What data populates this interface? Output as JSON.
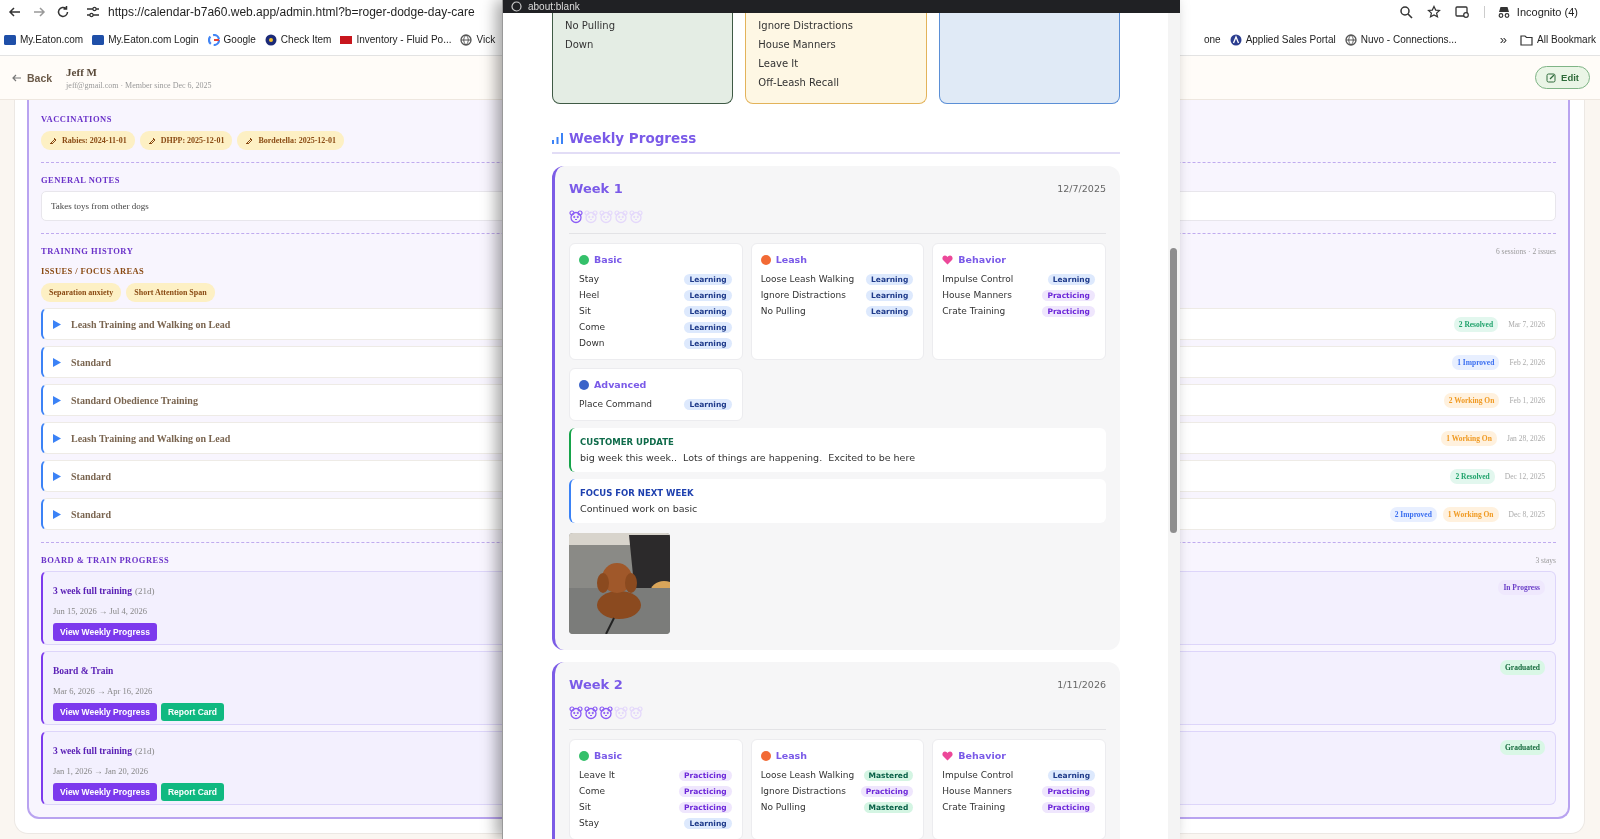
{
  "browser": {
    "url": "https://calendar-b7a60.web.app/admin.html?b=roger-dodge-day-care",
    "profile": "Incognito (4)",
    "bookmarks_left": [
      {
        "label": "My.Eaton.com"
      },
      {
        "label": "My.Eaton.com Login"
      },
      {
        "label": "Google"
      },
      {
        "label": "Check Item"
      },
      {
        "label": "Inventory - Fluid Po..."
      },
      {
        "label": "Vick"
      }
    ],
    "bookmarks_right": [
      {
        "label": "one"
      },
      {
        "label": "Applied Sales Portal"
      },
      {
        "label": "Nuvo - Connections..."
      }
    ],
    "more": "»",
    "all_bookmarks": "All Bookmark"
  },
  "page": {
    "back": "Back",
    "name": "Jeff M",
    "meta": "jeff@gmail.com · Member since Dec 6, 2025",
    "edit": "Edit",
    "vaccinations": {
      "heading": "VACCINATIONS",
      "items": [
        "Rabies: 2024-11-01",
        "DHPP: 2025-12-01",
        "Bordetella: 2025-12-01"
      ]
    },
    "notes": {
      "heading": "GENERAL NOTES",
      "value": "Takes toys from other dogs"
    },
    "training": {
      "heading": "TRAINING HISTORY",
      "summary": "6 sessions · 2 issues",
      "issues_heading": "ISSUES / FOCUS AREAS",
      "issues": [
        "Separation anxiety",
        "Short Attention Span"
      ],
      "sessions": [
        {
          "title": "Leash Training and Walking on Lead",
          "expanded": false,
          "badges": [
            {
              "label": "2 Resolved",
              "kind": "resolved"
            }
          ],
          "date": "Mar 7, 2026"
        },
        {
          "title": "Standard",
          "expanded": false,
          "badges": [
            {
              "label": "1 Improved",
              "kind": "improved"
            }
          ],
          "date": "Feb 2, 2026"
        },
        {
          "title": "Standard Obedience Training",
          "expanded": false,
          "badges": [
            {
              "label": "2 Working On",
              "kind": "working"
            }
          ],
          "date": "Feb 1, 2026"
        },
        {
          "title": "Leash Training and Walking on Lead",
          "expanded": false,
          "badges": [
            {
              "label": "1 Working On",
              "kind": "working"
            }
          ],
          "date": "Jan 28, 2026"
        },
        {
          "title": "Standard",
          "expanded": false,
          "badges": [
            {
              "label": "2 Resolved",
              "kind": "resolved"
            }
          ],
          "date": "Dec 12, 2025"
        },
        {
          "title": "Standard",
          "expanded": false,
          "badges": [
            {
              "label": "2 Improved",
              "kind": "improved"
            },
            {
              "label": "1 Working On",
              "kind": "working"
            }
          ],
          "date": "Dec 8, 2025"
        }
      ]
    },
    "board": {
      "heading": "BOARD & TRAIN PROGRESS",
      "summary": "3 stays",
      "stays": [
        {
          "title": "3 week full training",
          "duration": "(21d)",
          "dates": "Jun 15, 2026 → Jul 4, 2026",
          "status": {
            "label": "In Progress",
            "kind": "in-progress"
          },
          "buttons": [
            {
              "label": "View Weekly Progress",
              "kind": "progress"
            }
          ]
        },
        {
          "title": "Board & Train",
          "dates": "Mar 6, 2026 → Apr 16, 2026",
          "status": {
            "label": "Graduated",
            "kind": "graduated"
          },
          "buttons": [
            {
              "label": "View Weekly Progress",
              "kind": "progress"
            },
            {
              "label": "Report Card",
              "kind": "report"
            }
          ]
        },
        {
          "title": "3 week full training",
          "duration": "(21d)",
          "dates": "Jan 1, 2026 → Jan 20, 2026",
          "status": {
            "label": "Graduated",
            "kind": "graduated"
          },
          "buttons": [
            {
              "label": "View Weekly Progress",
              "kind": "progress"
            },
            {
              "label": "Report Card",
              "kind": "report"
            }
          ]
        }
      ]
    }
  },
  "popup": {
    "title": "about:blank",
    "summary_cards": [
      {
        "kind": "green",
        "items": [
          "No Pulling",
          "Down"
        ]
      },
      {
        "kind": "yellow",
        "items": [
          "Ignore Distractions",
          "House Manners",
          "Leave It",
          "Off-Leash Recall"
        ]
      },
      {
        "kind": "blue"
      }
    ],
    "heading": "Weekly Progress",
    "weeks": [
      {
        "title": "Week 1",
        "date": "12/7/2025",
        "stars": 1,
        "categories": [
          {
            "name": "Basic",
            "kind": "dot",
            "color": "#34c06a",
            "skills": [
              {
                "name": "Stay",
                "status": "Learning",
                "kind": "learning"
              },
              {
                "name": "Heel",
                "status": "Learning",
                "kind": "learning"
              },
              {
                "name": "Sit",
                "status": "Learning",
                "kind": "learning"
              },
              {
                "name": "Come",
                "status": "Learning",
                "kind": "learning"
              },
              {
                "name": "Down",
                "status": "Learning",
                "kind": "learning"
              }
            ]
          },
          {
            "name": "Leash",
            "kind": "dot",
            "color": "#f26a35",
            "skills": [
              {
                "name": "Loose Leash Walking",
                "status": "Learning",
                "kind": "learning"
              },
              {
                "name": "Ignore Distractions",
                "status": "Learning",
                "kind": "learning"
              },
              {
                "name": "No Pulling",
                "status": "Learning",
                "kind": "learning"
              }
            ]
          },
          {
            "name": "Behavior",
            "kind": "heart",
            "color": "#ec4899",
            "skills": [
              {
                "name": "Impulse Control",
                "status": "Learning",
                "kind": "learning"
              },
              {
                "name": "House Manners",
                "status": "Practicing",
                "kind": "practicing"
              },
              {
                "name": "Crate Training",
                "status": "Practicing",
                "kind": "practicing"
              }
            ]
          },
          {
            "name": "Advanced",
            "kind": "dot",
            "color": "#3b63c9",
            "skills": [
              {
                "name": "Place Command",
                "status": "Learning",
                "kind": "learning"
              }
            ]
          }
        ],
        "customer_update": {
          "heading": "CUSTOMER UPDATE",
          "text": "big week this week..  Lots of things are happening.  Excited to be here"
        },
        "focus": {
          "heading": "FOCUS FOR NEXT WEEK",
          "text": "Continued work on basic"
        },
        "photos": [
          {
            "kind": "picture"
          }
        ]
      },
      {
        "title": "Week 2",
        "date": "1/11/2026",
        "stars": 3,
        "categories": [
          {
            "name": "Basic",
            "kind": "dot",
            "color": "#34c06a",
            "skills": [
              {
                "name": "Leave It",
                "status": "Practicing",
                "kind": "practicing"
              },
              {
                "name": "Come",
                "status": "Practicing",
                "kind": "practicing"
              },
              {
                "name": "Sit",
                "status": "Practicing",
                "kind": "practicing"
              },
              {
                "name": "Stay",
                "status": "Learning",
                "kind": "learning"
              }
            ]
          },
          {
            "name": "Leash",
            "kind": "dot",
            "color": "#f26a35",
            "skills": [
              {
                "name": "Loose Leash Walking",
                "status": "Mastered",
                "kind": "mastered"
              },
              {
                "name": "Ignore Distractions",
                "status": "Practicing",
                "kind": "practicing"
              },
              {
                "name": "No Pulling",
                "status": "Mastered",
                "kind": "mastered"
              }
            ]
          },
          {
            "name": "Behavior",
            "kind": "heart",
            "color": "#ec4899",
            "skills": [
              {
                "name": "Impulse Control",
                "status": "Learning",
                "kind": "learning"
              },
              {
                "name": "House Manners",
                "status": "Practicing",
                "kind": "practicing"
              },
              {
                "name": "Crate Training",
                "status": "Practicing",
                "kind": "practicing"
              }
            ]
          }
        ]
      }
    ]
  }
}
